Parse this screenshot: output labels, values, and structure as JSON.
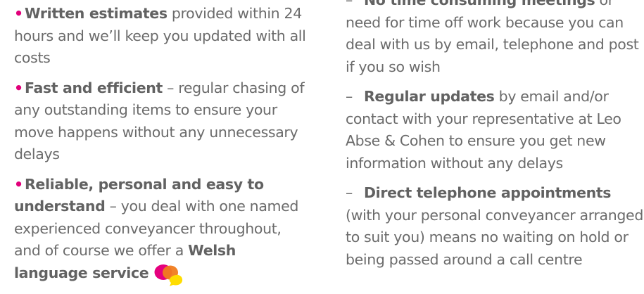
{
  "left_list": [
    {
      "marker": "•",
      "bold": "Written estimates",
      "text": " provided within 24 hours and we’ll keep you updated with all costs"
    },
    {
      "marker": "•",
      "bold": "Fast and efficient",
      "text": " – regular chasing of any outstanding items to ensure your move happens without any unnecessary delays"
    },
    {
      "marker": "•",
      "bold": "Reliable, personal and easy to understand",
      "text": " – you deal with one named experienced conveyancer throughout, and of course we offer a ",
      "bold2": "Welsh language service"
    }
  ],
  "right_list": [
    {
      "marker": "–",
      "bold": "No time consuming meetings",
      "text": " or need for time off work because you can deal with us by email, telephone and post if you so wish"
    },
    {
      "marker": "–",
      "bold": "Regular updates",
      "text": " by email and/or contact with your representative at Leo Abse & Cohen to ensure you get new information without any delays"
    },
    {
      "marker": "–",
      "bold": "Direct telephone appointments",
      "text": " (with your personal conveyancer arranged to suit you) means no waiting on hold or being passed around a call centre"
    }
  ],
  "colors": {
    "bullet": "#e1007a",
    "text": "#6b6b6b",
    "bubble_pink": "#e5007e",
    "bubble_orange": "#f07c1e",
    "bubble_yellow": "#ffdd00"
  },
  "icons": {
    "welsh_language": "speech-bubbles-icon"
  }
}
